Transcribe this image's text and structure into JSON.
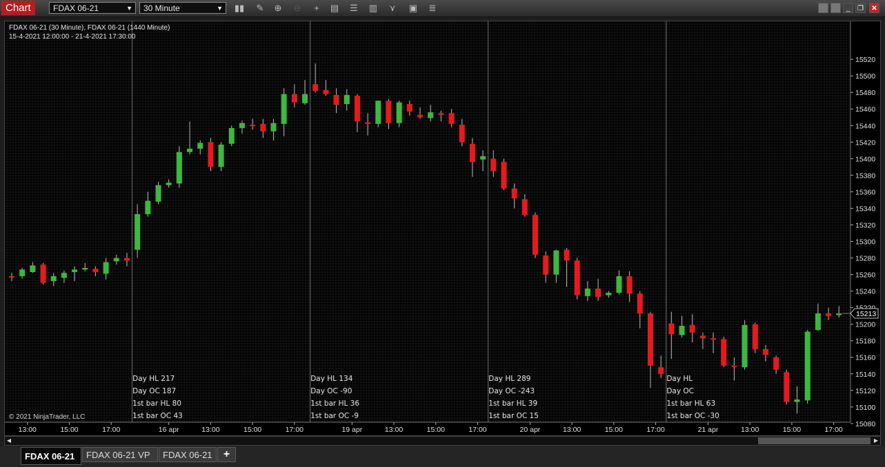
{
  "toolbar": {
    "title": "Chart",
    "instrument": "FDAX 06-21",
    "interval": "30 Minute",
    "tool_icons": [
      "bar-chart-icon",
      "pencil-icon",
      "zoom-in-icon",
      "zoom-out-icon",
      "crosshair-icon",
      "data-box-icon",
      "properties-icon",
      "indicators-icon",
      "strategies-icon",
      "templates-icon",
      "list-icon"
    ],
    "window_icons": [
      "tile-icon",
      "tile-icon",
      "minimize-icon",
      "restore-icon",
      "close-icon"
    ]
  },
  "chart": {
    "header_line1": "FDAX 06-21 (30 Minute), FDAX 06-21 (1440 Minute)",
    "header_line2": "15-4-2021 12:00:00 - 21-4-2021 17:30:00",
    "copyright": "© 2021 NinjaTrader, LLC",
    "last_price": "15213",
    "colors": {
      "up": "#3cb93c",
      "down": "#e8191e",
      "wick": "#bdbdbd",
      "grid": "#161616"
    }
  },
  "chart_data": {
    "type": "candlestick",
    "y_ticks": [
      15080,
      15100,
      15120,
      15140,
      15160,
      15180,
      15200,
      15220,
      15240,
      15260,
      15280,
      15300,
      15320,
      15340,
      15360,
      15380,
      15400,
      15420,
      15440,
      15460,
      15480,
      15500,
      15520
    ],
    "ylim": [
      15068,
      15542
    ],
    "x_tick_labels": [
      {
        "bar": 1.5,
        "label": "13:00"
      },
      {
        "bar": 5.5,
        "label": "15:00"
      },
      {
        "bar": 9.5,
        "label": "17:00"
      },
      {
        "bar": 15,
        "label": "16 apr"
      },
      {
        "bar": 19,
        "label": "13:00"
      },
      {
        "bar": 23,
        "label": "15:00"
      },
      {
        "bar": 27,
        "label": "17:00"
      },
      {
        "bar": 32.5,
        "label": "19 apr"
      },
      {
        "bar": 36.5,
        "label": "13:00"
      },
      {
        "bar": 40.5,
        "label": "15:00"
      },
      {
        "bar": 44.5,
        "label": "17:00"
      },
      {
        "bar": 49.5,
        "label": "20 apr"
      },
      {
        "bar": 53.5,
        "label": "13:00"
      },
      {
        "bar": 57.5,
        "label": "15:00"
      },
      {
        "bar": 61.5,
        "label": "17:00"
      },
      {
        "bar": 66.5,
        "label": "21 apr"
      },
      {
        "bar": 70.5,
        "label": "13:00"
      },
      {
        "bar": 74.5,
        "label": "15:00"
      },
      {
        "bar": 78.5,
        "label": "17:00"
      }
    ],
    "session_breaks": [
      11.5,
      28.5,
      45.5,
      62.5
    ],
    "candles": [
      {
        "o": 15258,
        "h": 15262,
        "l": 15252,
        "c": 15257
      },
      {
        "o": 15258,
        "h": 15268,
        "l": 15255,
        "c": 15266
      },
      {
        "o": 15263,
        "h": 15275,
        "l": 15262,
        "c": 15271
      },
      {
        "o": 15272,
        "h": 15274,
        "l": 15248,
        "c": 15250
      },
      {
        "o": 15252,
        "h": 15262,
        "l": 15246,
        "c": 15258
      },
      {
        "o": 15256,
        "h": 15265,
        "l": 15250,
        "c": 15262
      },
      {
        "o": 15263,
        "h": 15270,
        "l": 15252,
        "c": 15266
      },
      {
        "o": 15266,
        "h": 15274,
        "l": 15264,
        "c": 15268
      },
      {
        "o": 15267,
        "h": 15270,
        "l": 15258,
        "c": 15263
      },
      {
        "o": 15261,
        "h": 15280,
        "l": 15254,
        "c": 15275
      },
      {
        "o": 15276,
        "h": 15284,
        "l": 15272,
        "c": 15280
      },
      {
        "o": 15280,
        "h": 15286,
        "l": 15270,
        "c": 15277
      },
      {
        "o": 15290,
        "h": 15345,
        "l": 15280,
        "c": 15333
      },
      {
        "o": 15333,
        "h": 15360,
        "l": 15330,
        "c": 15349
      },
      {
        "o": 15348,
        "h": 15372,
        "l": 15345,
        "c": 15368
      },
      {
        "o": 15368,
        "h": 15375,
        "l": 15365,
        "c": 15371
      },
      {
        "o": 15370,
        "h": 15415,
        "l": 15365,
        "c": 15408
      },
      {
        "o": 15408,
        "h": 15445,
        "l": 15405,
        "c": 15412
      },
      {
        "o": 15412,
        "h": 15422,
        "l": 15405,
        "c": 15419
      },
      {
        "o": 15420,
        "h": 15425,
        "l": 15385,
        "c": 15390
      },
      {
        "o": 15390,
        "h": 15420,
        "l": 15385,
        "c": 15417
      },
      {
        "o": 15418,
        "h": 15440,
        "l": 15415,
        "c": 15437
      },
      {
        "o": 15437,
        "h": 15446,
        "l": 15430,
        "c": 15443
      },
      {
        "o": 15441,
        "h": 15448,
        "l": 15435,
        "c": 15440
      },
      {
        "o": 15442,
        "h": 15448,
        "l": 15425,
        "c": 15433
      },
      {
        "o": 15433,
        "h": 15448,
        "l": 15422,
        "c": 15443
      },
      {
        "o": 15442,
        "h": 15485,
        "l": 15427,
        "c": 15478
      },
      {
        "o": 15478,
        "h": 15490,
        "l": 15462,
        "c": 15468
      },
      {
        "o": 15467,
        "h": 15495,
        "l": 15465,
        "c": 15478
      },
      {
        "o": 15490,
        "h": 15515,
        "l": 15480,
        "c": 15482
      },
      {
        "o": 15483,
        "h": 15495,
        "l": 15476,
        "c": 15478
      },
      {
        "o": 15477,
        "h": 15485,
        "l": 15455,
        "c": 15465
      },
      {
        "o": 15466,
        "h": 15484,
        "l": 15458,
        "c": 15477
      },
      {
        "o": 15476,
        "h": 15478,
        "l": 15432,
        "c": 15445
      },
      {
        "o": 15444,
        "h": 15455,
        "l": 15428,
        "c": 15442
      },
      {
        "o": 15442,
        "h": 15470,
        "l": 15438,
        "c": 15470
      },
      {
        "o": 15470,
        "h": 15472,
        "l": 15436,
        "c": 15443
      },
      {
        "o": 15443,
        "h": 15470,
        "l": 15438,
        "c": 15468
      },
      {
        "o": 15466,
        "h": 15470,
        "l": 15452,
        "c": 15457
      },
      {
        "o": 15453,
        "h": 15462,
        "l": 15448,
        "c": 15450
      },
      {
        "o": 15449,
        "h": 15465,
        "l": 15445,
        "c": 15456
      },
      {
        "o": 15455,
        "h": 15458,
        "l": 15445,
        "c": 15453
      },
      {
        "o": 15455,
        "h": 15460,
        "l": 15438,
        "c": 15442
      },
      {
        "o": 15441,
        "h": 15448,
        "l": 15415,
        "c": 15420
      },
      {
        "o": 15418,
        "h": 15425,
        "l": 15378,
        "c": 15396
      },
      {
        "o": 15399,
        "h": 15410,
        "l": 15385,
        "c": 15403
      },
      {
        "o": 15400,
        "h": 15410,
        "l": 15378,
        "c": 15385
      },
      {
        "o": 15396,
        "h": 15400,
        "l": 15362,
        "c": 15364
      },
      {
        "o": 15364,
        "h": 15370,
        "l": 15340,
        "c": 15352
      },
      {
        "o": 15351,
        "h": 15357,
        "l": 15330,
        "c": 15332
      },
      {
        "o": 15332,
        "h": 15335,
        "l": 15280,
        "c": 15284
      },
      {
        "o": 15283,
        "h": 15288,
        "l": 15250,
        "c": 15260
      },
      {
        "o": 15260,
        "h": 15290,
        "l": 15250,
        "c": 15289
      },
      {
        "o": 15290,
        "h": 15292,
        "l": 15245,
        "c": 15277
      },
      {
        "o": 15277,
        "h": 15280,
        "l": 15230,
        "c": 15235
      },
      {
        "o": 15234,
        "h": 15252,
        "l": 15228,
        "c": 15243
      },
      {
        "o": 15243,
        "h": 15255,
        "l": 15228,
        "c": 15233
      },
      {
        "o": 15235,
        "h": 15240,
        "l": 15232,
        "c": 15238
      },
      {
        "o": 15238,
        "h": 15265,
        "l": 15236,
        "c": 15258
      },
      {
        "o": 15258,
        "h": 15264,
        "l": 15227,
        "c": 15237
      },
      {
        "o": 15237,
        "h": 15240,
        "l": 15195,
        "c": 15213
      },
      {
        "o": 15213,
        "h": 15215,
        "l": 15123,
        "c": 15150
      },
      {
        "o": 15148,
        "h": 15162,
        "l": 15135,
        "c": 15140
      },
      {
        "o": 15201,
        "h": 15215,
        "l": 15158,
        "c": 15188
      },
      {
        "o": 15187,
        "h": 15210,
        "l": 15184,
        "c": 15198
      },
      {
        "o": 15199,
        "h": 15212,
        "l": 15178,
        "c": 15190
      },
      {
        "o": 15186,
        "h": 15190,
        "l": 15170,
        "c": 15183
      },
      {
        "o": 15183,
        "h": 15190,
        "l": 15165,
        "c": 15182
      },
      {
        "o": 15182,
        "h": 15185,
        "l": 15148,
        "c": 15150
      },
      {
        "o": 15150,
        "h": 15160,
        "l": 15132,
        "c": 15149
      },
      {
        "o": 15148,
        "h": 15205,
        "l": 15145,
        "c": 15199
      },
      {
        "o": 15200,
        "h": 15202,
        "l": 15165,
        "c": 15170
      },
      {
        "o": 15170,
        "h": 15175,
        "l": 15155,
        "c": 15163
      },
      {
        "o": 15160,
        "h": 15162,
        "l": 15140,
        "c": 15145
      },
      {
        "o": 15142,
        "h": 15145,
        "l": 15103,
        "c": 15106
      },
      {
        "o": 15106,
        "h": 15125,
        "l": 15092,
        "c": 15109
      },
      {
        "o": 15108,
        "h": 15193,
        "l": 15104,
        "c": 15191
      },
      {
        "o": 15193,
        "h": 15225,
        "l": 15192,
        "c": 15213
      },
      {
        "o": 15213,
        "h": 15220,
        "l": 15205,
        "c": 15210
      },
      {
        "o": 15211,
        "h": 15222,
        "l": 15208,
        "c": 15213
      }
    ],
    "stats": [
      {
        "bar": 12,
        "lines": [
          "Day HL 217",
          "Day OC 187",
          "1st bar HL 80",
          "1st bar OC 43"
        ]
      },
      {
        "bar": 29,
        "lines": [
          "Day HL 134",
          "Day OC -90",
          "1st bar HL 36",
          "1st bar OC -9"
        ]
      },
      {
        "bar": 46,
        "lines": [
          "Day HL 289",
          "Day OC -243",
          "1st bar HL 39",
          "1st bar OC 15"
        ]
      },
      {
        "bar": 63,
        "lines": [
          "Day HL",
          "Day OC",
          "1st bar HL 63",
          "1st bar OC -30"
        ]
      }
    ]
  },
  "tabs": [
    {
      "label": "FDAX 06-21",
      "active": true
    },
    {
      "label": "FDAX 06-21 VP",
      "active": false
    },
    {
      "label": "FDAX 06-21",
      "active": false
    }
  ],
  "tab_add": "+"
}
